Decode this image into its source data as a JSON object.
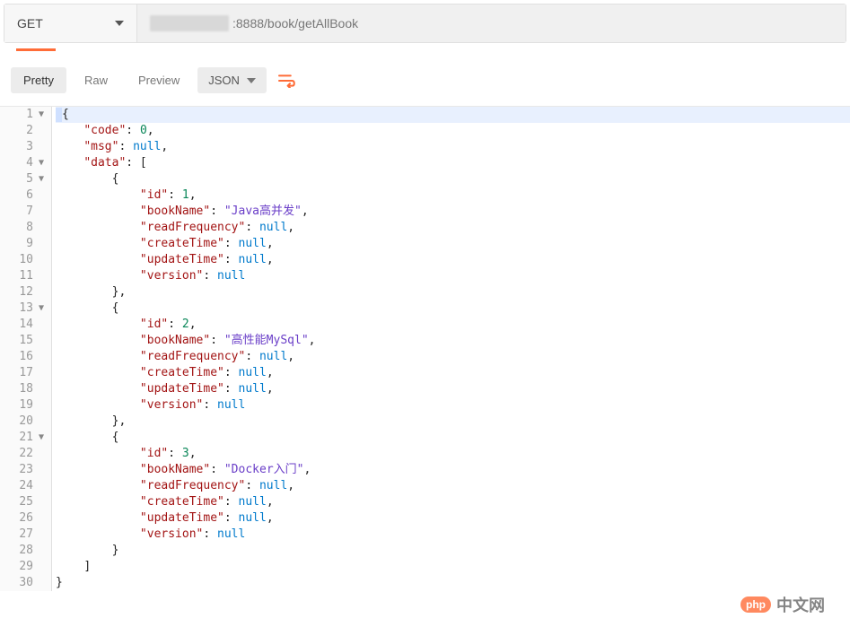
{
  "topbar": {
    "method": "GET",
    "url_visible": ":8888/book/getAllBook"
  },
  "toolbar": {
    "tabs": {
      "pretty": "Pretty",
      "raw": "Raw",
      "preview": "Preview"
    },
    "format_dd": "JSON"
  },
  "lines": [
    {
      "num": "1",
      "fold": true,
      "indent": 0,
      "tokens": [
        {
          "t": "p",
          "v": "{ "
        }
      ],
      "current": true
    },
    {
      "num": "2",
      "fold": false,
      "indent": 1,
      "tokens": [
        {
          "t": "k",
          "v": "\"code\""
        },
        {
          "t": "p",
          "v": ": "
        },
        {
          "t": "n",
          "v": "0"
        },
        {
          "t": "p",
          "v": ","
        }
      ]
    },
    {
      "num": "3",
      "fold": false,
      "indent": 1,
      "tokens": [
        {
          "t": "k",
          "v": "\"msg\""
        },
        {
          "t": "p",
          "v": ": "
        },
        {
          "t": "u",
          "v": "null"
        },
        {
          "t": "p",
          "v": ","
        }
      ]
    },
    {
      "num": "4",
      "fold": true,
      "indent": 1,
      "tokens": [
        {
          "t": "k",
          "v": "\"data\""
        },
        {
          "t": "p",
          "v": ": ["
        }
      ]
    },
    {
      "num": "5",
      "fold": true,
      "indent": 2,
      "tokens": [
        {
          "t": "p",
          "v": "{"
        }
      ]
    },
    {
      "num": "6",
      "fold": false,
      "indent": 3,
      "tokens": [
        {
          "t": "k",
          "v": "\"id\""
        },
        {
          "t": "p",
          "v": ": "
        },
        {
          "t": "n",
          "v": "1"
        },
        {
          "t": "p",
          "v": ","
        }
      ]
    },
    {
      "num": "7",
      "fold": false,
      "indent": 3,
      "tokens": [
        {
          "t": "k",
          "v": "\"bookName\""
        },
        {
          "t": "p",
          "v": ": "
        },
        {
          "t": "s",
          "v": "\"Java高并发\""
        },
        {
          "t": "p",
          "v": ","
        }
      ]
    },
    {
      "num": "8",
      "fold": false,
      "indent": 3,
      "tokens": [
        {
          "t": "k",
          "v": "\"readFrequency\""
        },
        {
          "t": "p",
          "v": ": "
        },
        {
          "t": "u",
          "v": "null"
        },
        {
          "t": "p",
          "v": ","
        }
      ]
    },
    {
      "num": "9",
      "fold": false,
      "indent": 3,
      "tokens": [
        {
          "t": "k",
          "v": "\"createTime\""
        },
        {
          "t": "p",
          "v": ": "
        },
        {
          "t": "u",
          "v": "null"
        },
        {
          "t": "p",
          "v": ","
        }
      ]
    },
    {
      "num": "10",
      "fold": false,
      "indent": 3,
      "tokens": [
        {
          "t": "k",
          "v": "\"updateTime\""
        },
        {
          "t": "p",
          "v": ": "
        },
        {
          "t": "u",
          "v": "null"
        },
        {
          "t": "p",
          "v": ","
        }
      ]
    },
    {
      "num": "11",
      "fold": false,
      "indent": 3,
      "tokens": [
        {
          "t": "k",
          "v": "\"version\""
        },
        {
          "t": "p",
          "v": ": "
        },
        {
          "t": "u",
          "v": "null"
        }
      ]
    },
    {
      "num": "12",
      "fold": false,
      "indent": 2,
      "tokens": [
        {
          "t": "p",
          "v": "},"
        }
      ]
    },
    {
      "num": "13",
      "fold": true,
      "indent": 2,
      "tokens": [
        {
          "t": "p",
          "v": "{"
        }
      ]
    },
    {
      "num": "14",
      "fold": false,
      "indent": 3,
      "tokens": [
        {
          "t": "k",
          "v": "\"id\""
        },
        {
          "t": "p",
          "v": ": "
        },
        {
          "t": "n",
          "v": "2"
        },
        {
          "t": "p",
          "v": ","
        }
      ]
    },
    {
      "num": "15",
      "fold": false,
      "indent": 3,
      "tokens": [
        {
          "t": "k",
          "v": "\"bookName\""
        },
        {
          "t": "p",
          "v": ": "
        },
        {
          "t": "s",
          "v": "\"高性能MySql\""
        },
        {
          "t": "p",
          "v": ","
        }
      ]
    },
    {
      "num": "16",
      "fold": false,
      "indent": 3,
      "tokens": [
        {
          "t": "k",
          "v": "\"readFrequency\""
        },
        {
          "t": "p",
          "v": ": "
        },
        {
          "t": "u",
          "v": "null"
        },
        {
          "t": "p",
          "v": ","
        }
      ]
    },
    {
      "num": "17",
      "fold": false,
      "indent": 3,
      "tokens": [
        {
          "t": "k",
          "v": "\"createTime\""
        },
        {
          "t": "p",
          "v": ": "
        },
        {
          "t": "u",
          "v": "null"
        },
        {
          "t": "p",
          "v": ","
        }
      ]
    },
    {
      "num": "18",
      "fold": false,
      "indent": 3,
      "tokens": [
        {
          "t": "k",
          "v": "\"updateTime\""
        },
        {
          "t": "p",
          "v": ": "
        },
        {
          "t": "u",
          "v": "null"
        },
        {
          "t": "p",
          "v": ","
        }
      ]
    },
    {
      "num": "19",
      "fold": false,
      "indent": 3,
      "tokens": [
        {
          "t": "k",
          "v": "\"version\""
        },
        {
          "t": "p",
          "v": ": "
        },
        {
          "t": "u",
          "v": "null"
        }
      ]
    },
    {
      "num": "20",
      "fold": false,
      "indent": 2,
      "tokens": [
        {
          "t": "p",
          "v": "},"
        }
      ]
    },
    {
      "num": "21",
      "fold": true,
      "indent": 2,
      "tokens": [
        {
          "t": "p",
          "v": "{"
        }
      ]
    },
    {
      "num": "22",
      "fold": false,
      "indent": 3,
      "tokens": [
        {
          "t": "k",
          "v": "\"id\""
        },
        {
          "t": "p",
          "v": ": "
        },
        {
          "t": "n",
          "v": "3"
        },
        {
          "t": "p",
          "v": ","
        }
      ]
    },
    {
      "num": "23",
      "fold": false,
      "indent": 3,
      "tokens": [
        {
          "t": "k",
          "v": "\"bookName\""
        },
        {
          "t": "p",
          "v": ": "
        },
        {
          "t": "s",
          "v": "\"Docker入门\""
        },
        {
          "t": "p",
          "v": ","
        }
      ]
    },
    {
      "num": "24",
      "fold": false,
      "indent": 3,
      "tokens": [
        {
          "t": "k",
          "v": "\"readFrequency\""
        },
        {
          "t": "p",
          "v": ": "
        },
        {
          "t": "u",
          "v": "null"
        },
        {
          "t": "p",
          "v": ","
        }
      ]
    },
    {
      "num": "25",
      "fold": false,
      "indent": 3,
      "tokens": [
        {
          "t": "k",
          "v": "\"createTime\""
        },
        {
          "t": "p",
          "v": ": "
        },
        {
          "t": "u",
          "v": "null"
        },
        {
          "t": "p",
          "v": ","
        }
      ]
    },
    {
      "num": "26",
      "fold": false,
      "indent": 3,
      "tokens": [
        {
          "t": "k",
          "v": "\"updateTime\""
        },
        {
          "t": "p",
          "v": ": "
        },
        {
          "t": "u",
          "v": "null"
        },
        {
          "t": "p",
          "v": ","
        }
      ]
    },
    {
      "num": "27",
      "fold": false,
      "indent": 3,
      "tokens": [
        {
          "t": "k",
          "v": "\"version\""
        },
        {
          "t": "p",
          "v": ": "
        },
        {
          "t": "u",
          "v": "null"
        }
      ]
    },
    {
      "num": "28",
      "fold": false,
      "indent": 2,
      "tokens": [
        {
          "t": "p",
          "v": "}"
        }
      ]
    },
    {
      "num": "29",
      "fold": false,
      "indent": 1,
      "tokens": [
        {
          "t": "p",
          "v": "]"
        }
      ]
    },
    {
      "num": "30",
      "fold": false,
      "indent": 0,
      "tokens": [
        {
          "t": "p",
          "v": "}"
        }
      ]
    }
  ],
  "watermark": {
    "badge": "php",
    "text": "中文网"
  }
}
